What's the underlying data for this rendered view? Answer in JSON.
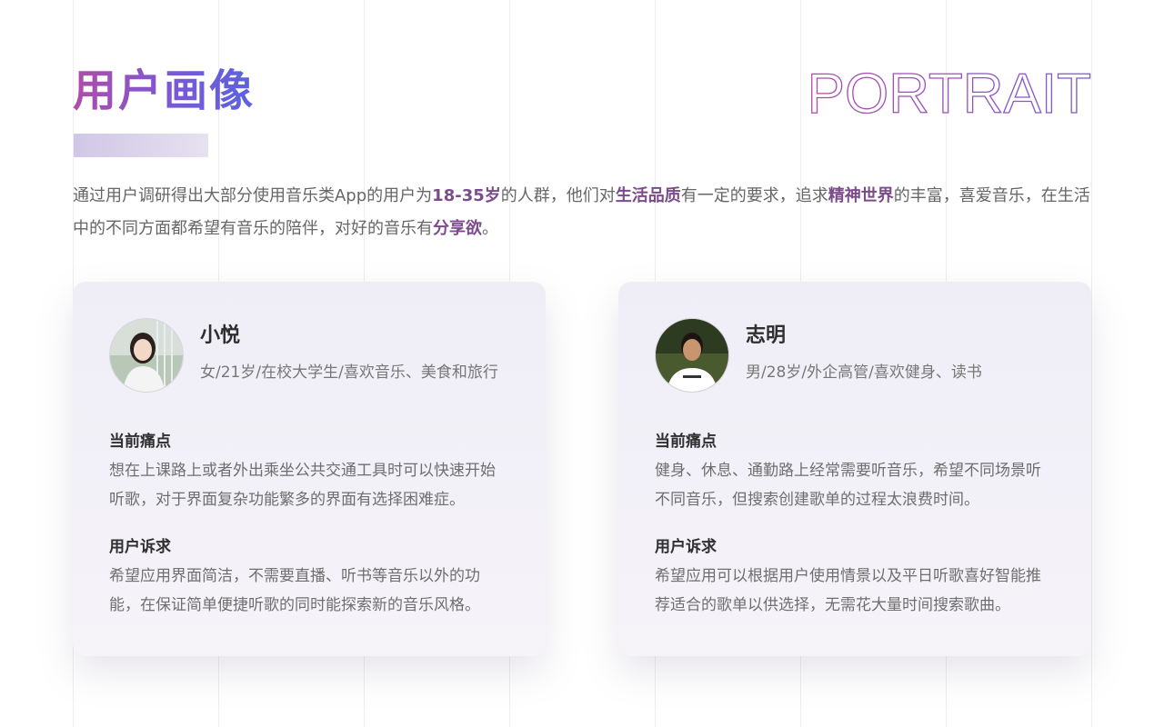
{
  "header": {
    "title": "用户画像",
    "portrait_word": "PORTRAIT"
  },
  "intro": {
    "parts": [
      {
        "text": "通过用户调研得出大部分使用音乐类App的用户为",
        "hl": false
      },
      {
        "text": "18-35岁",
        "hl": true
      },
      {
        "text": "的人群，他们对",
        "hl": false
      },
      {
        "text": "生活品质",
        "hl": true
      },
      {
        "text": "有一定的要求，追求",
        "hl": false
      },
      {
        "text": "精神世界",
        "hl": true
      },
      {
        "text": "的丰富，喜爱音乐，在生活中的不同方面都希望有音乐的陪伴，对好的音乐有",
        "hl": false
      },
      {
        "text": "分享欲",
        "hl": true
      },
      {
        "text": "。",
        "hl": false
      }
    ]
  },
  "personas": [
    {
      "name": "小悦",
      "meta": "女/21岁/在校大学生/喜欢音乐、美食和旅行",
      "pain_title": "当前痛点",
      "pain_text": "想在上课路上或者外出乘坐公共交通工具时可以快速开始听歌，对于界面复杂功能繁多的界面有选择困难症。",
      "need_title": "用户诉求",
      "need_text": "希望应用界面简洁，不需要直播、听书等音乐以外的功能，在保证简单便捷听歌的同时能探索新的音乐风格。"
    },
    {
      "name": "志明",
      "meta": "男/28岁/外企高管/喜欢健身、读书",
      "pain_title": "当前痛点",
      "pain_text": "健身、休息、通勤路上经常需要听音乐，希望不同场景听不同音乐，但搜索创建歌单的过程太浪费时间。",
      "need_title": "用户诉求",
      "need_text": "希望应用可以根据用户使用情景以及平日听歌喜好智能推荐适合的歌单以供选择，无需花大量时间搜索歌曲。"
    }
  ],
  "colors": {
    "accent": "#7b4c8a",
    "title_gradient_start": "#b04ca8",
    "title_gradient_end": "#5a63e0"
  }
}
